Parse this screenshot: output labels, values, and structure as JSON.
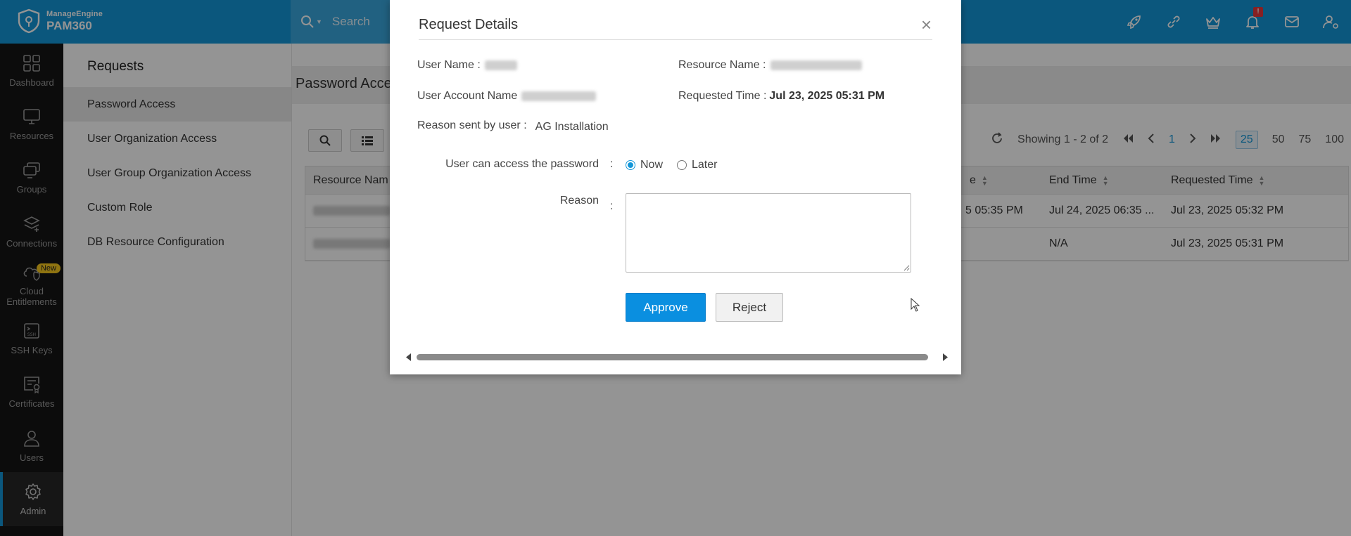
{
  "header": {
    "brand": "ManageEngine",
    "product": "PAM360",
    "search_placeholder": "Search",
    "notification_count": "!"
  },
  "sidebar": {
    "items": [
      {
        "label": "Dashboard",
        "icon": "dashboard-icon"
      },
      {
        "label": "Resources",
        "icon": "monitor-icon"
      },
      {
        "label": "Groups",
        "icon": "groups-icon"
      },
      {
        "label": "Connections",
        "icon": "connections-icon"
      },
      {
        "label": "Cloud Entitlements",
        "icon": "cloud-shield-icon",
        "badge": "New"
      },
      {
        "label": "SSH Keys",
        "icon": "ssh-key-icon"
      },
      {
        "label": "Certificates",
        "icon": "certificate-icon"
      },
      {
        "label": "Users",
        "icon": "user-icon"
      },
      {
        "label": "Admin",
        "icon": "gear-icon",
        "active": true
      }
    ]
  },
  "submenu": {
    "title": "Requests",
    "items": [
      {
        "label": "Password Access",
        "active": true
      },
      {
        "label": "User Organization Access"
      },
      {
        "label": "User Group Organization Access"
      },
      {
        "label": "Custom Role"
      },
      {
        "label": "DB Resource Configuration"
      }
    ]
  },
  "main": {
    "title": "Password Acce",
    "pager": {
      "showing": "Showing 1 - 2 of 2",
      "page": "1",
      "sizes": [
        "25",
        "50",
        "75",
        "100"
      ],
      "selected_size": "25"
    },
    "table": {
      "headers": [
        "Resource Nam",
        "e",
        "End Time",
        "Requested Time"
      ],
      "rows": [
        {
          "start": "5 05:35 PM",
          "end": "Jul 24, 2025 06:35 ...",
          "requested": "Jul 23, 2025 05:32 PM"
        },
        {
          "start": "",
          "end": "N/A",
          "requested": "Jul 23, 2025 05:31 PM"
        }
      ]
    }
  },
  "modal": {
    "title": "Request Details",
    "close": "×",
    "user_name_label": "User Name :",
    "resource_name_label": "Resource Name :",
    "user_account_label": "User Account Name",
    "requested_time_label": "Requested Time :",
    "requested_time_value": "Jul 23, 2025 05:31 PM",
    "reason_sent_label": "Reason sent by user :",
    "reason_sent_value": "AG Installation",
    "access_label": "User can access the password",
    "colon": ":",
    "option_now": "Now",
    "option_later": "Later",
    "reason_label": "Reason",
    "approve_label": "Approve",
    "reject_label": "Reject"
  },
  "colors": {
    "topbar": "#1497d8",
    "sidebar": "#161616",
    "approve": "#0a8fe0"
  }
}
